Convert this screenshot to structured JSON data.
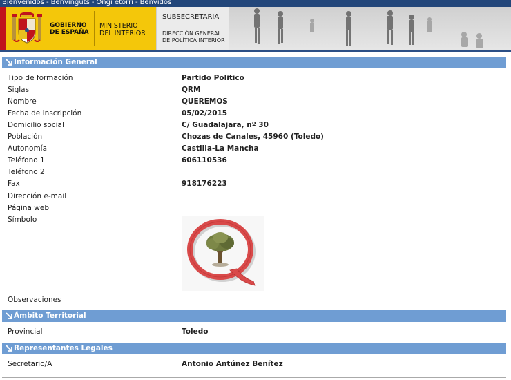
{
  "lang_bar": {
    "links": [
      "Bienvenidos",
      "Benvinguts",
      "Ongi etorri",
      "Benvidos"
    ],
    "separator": "-"
  },
  "header": {
    "gobierno_line1": "Gobierno",
    "gobierno_line2": "de España",
    "ministerio_line1": "Ministerio",
    "ministerio_line2": "del Interior",
    "subsecretaria": "Subsecretaria",
    "direccion_line1": "Dirección General",
    "direccion_line2": "de Política Interior"
  },
  "colors": {
    "section_bar": "#6f9dd3",
    "top_bar": "#22467a",
    "header_yellow": "#f4c70a",
    "logo_red": "#d94a4a"
  },
  "sections": {
    "general": {
      "title": "Información General",
      "fields": [
        {
          "label": "Tipo de formación",
          "value": "Partido Politico"
        },
        {
          "label": "Siglas",
          "value": "QRM"
        },
        {
          "label": "Nombre",
          "value": "QUEREMOS"
        },
        {
          "label": "Fecha de Inscripción",
          "value": "05/02/2015"
        },
        {
          "label": "Domicilio social",
          "value": "C/ Guadalajara, nº 30"
        },
        {
          "label": "Población",
          "value": "Chozas de Canales, 45960 (Toledo)"
        },
        {
          "label": "Autonomía",
          "value": "Castilla-La Mancha"
        },
        {
          "label": "Teléfono 1",
          "value": "606110536"
        },
        {
          "label": "Teléfono 2",
          "value": ""
        },
        {
          "label": "Fax",
          "value": "918176223"
        },
        {
          "label": "Dirección e-mail",
          "value": ""
        },
        {
          "label": "Página web",
          "value": ""
        },
        {
          "label": "Símbolo",
          "value": ""
        }
      ],
      "observaciones_label": "Observaciones"
    },
    "territorial": {
      "title": "Ámbito Territorial",
      "fields": [
        {
          "label": "Provincial",
          "value": "Toledo"
        }
      ]
    },
    "representantes": {
      "title": "Representantes Legales",
      "fields": [
        {
          "label": "Secretario/A",
          "value": "Antonio Antúnez Benítez"
        }
      ]
    }
  },
  "symbol_icon": "party-logo-q-olive-tree"
}
